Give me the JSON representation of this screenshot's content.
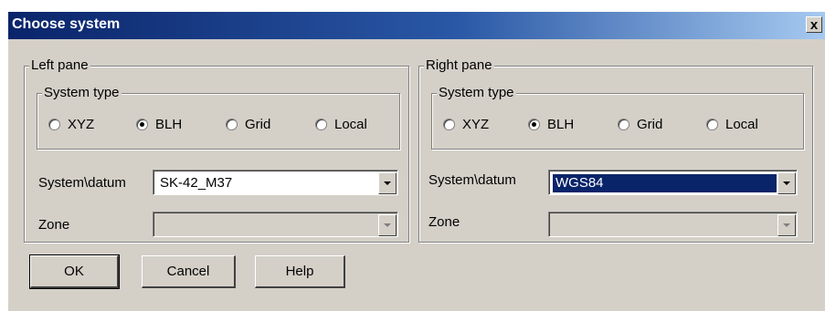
{
  "dialog": {
    "title": "Choose system",
    "close_label": "x"
  },
  "left_pane": {
    "title": "Left pane",
    "system_type_label": "System type",
    "radios": [
      {
        "label": "XYZ",
        "checked": false
      },
      {
        "label": "BLH",
        "checked": true
      },
      {
        "label": "Grid",
        "checked": false
      },
      {
        "label": "Local",
        "checked": false
      }
    ],
    "datum_label": "System\\datum",
    "datum_value": "SK-42_M37",
    "zone_label": "Zone",
    "zone_value": ""
  },
  "right_pane": {
    "title": "Right pane",
    "system_type_label": "System type",
    "radios": [
      {
        "label": "XYZ",
        "checked": false
      },
      {
        "label": "BLH",
        "checked": true
      },
      {
        "label": "Grid",
        "checked": false
      },
      {
        "label": "Local",
        "checked": false
      }
    ],
    "datum_label": "System\\datum",
    "datum_value": "WGS84",
    "zone_label": "Zone",
    "zone_value": ""
  },
  "buttons": {
    "ok": "OK",
    "cancel": "Cancel",
    "help": "Help"
  }
}
